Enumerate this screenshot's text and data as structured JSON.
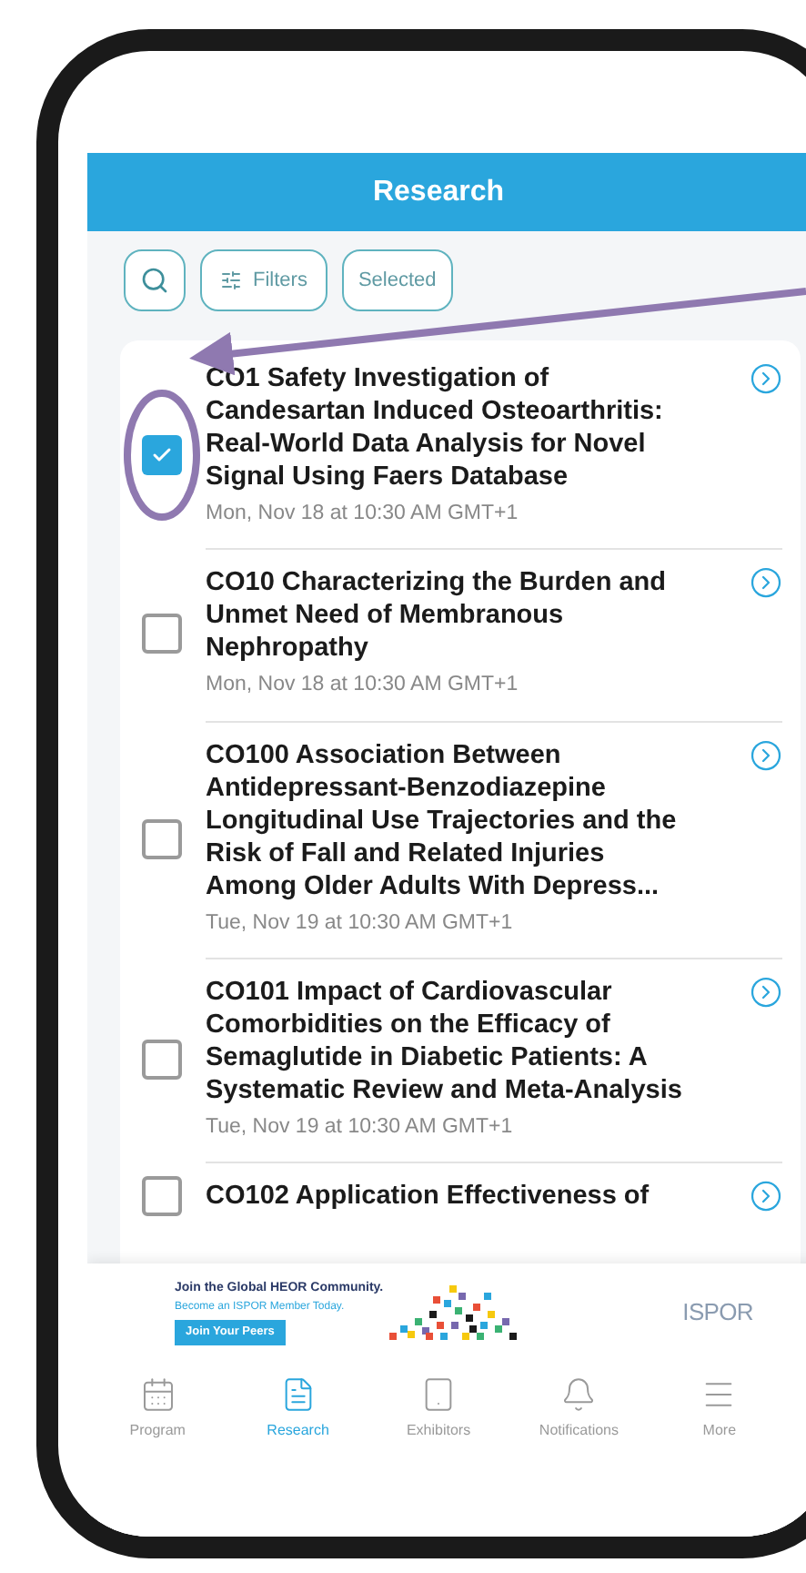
{
  "header": {
    "title": "Research"
  },
  "toolbar": {
    "filters": "Filters",
    "selected": "Selected"
  },
  "sessions": [
    {
      "title": "CO1 Safety Investigation of Candesartan Induced Osteoarthritis: Real-World Data Analysis for Novel Signal Using Faers Database",
      "time": "Mon, Nov 18 at 10:30 AM GMT+1",
      "checked": true
    },
    {
      "title": "CO10 Characterizing the Burden and Unmet Need of Membranous Nephropathy",
      "time": "Mon, Nov 18 at 10:30 AM GMT+1",
      "checked": false
    },
    {
      "title": "CO100 Association Between Antidepressant-Benzodiazepine Longitudinal Use Trajectories and the Risk of Fall and Related Injuries Among Older Adults With Depress...",
      "time": "Tue, Nov 19 at 10:30 AM GMT+1",
      "checked": false
    },
    {
      "title": "CO101 Impact of Cardiovascular Comorbidities on the Efficacy of Semaglutide in Diabetic Patients: A Systematic Review and Meta-Analysis",
      "time": "Tue, Nov 19 at 10:30 AM GMT+1",
      "checked": false
    },
    {
      "title": "CO102 Application Effectiveness of",
      "checked": false
    }
  ],
  "banner": {
    "headline": "Join the Global HEOR Community.",
    "subline": "Become an ISPOR Member Today.",
    "button": "Join Your Peers",
    "logo": "ISPOR"
  },
  "tab_bar": [
    {
      "label": "Program",
      "selected": false
    },
    {
      "label": "Research",
      "selected": true
    },
    {
      "label": "Exhibitors",
      "selected": false
    },
    {
      "label": "Notifications",
      "selected": false
    },
    {
      "label": "More",
      "selected": false
    }
  ]
}
